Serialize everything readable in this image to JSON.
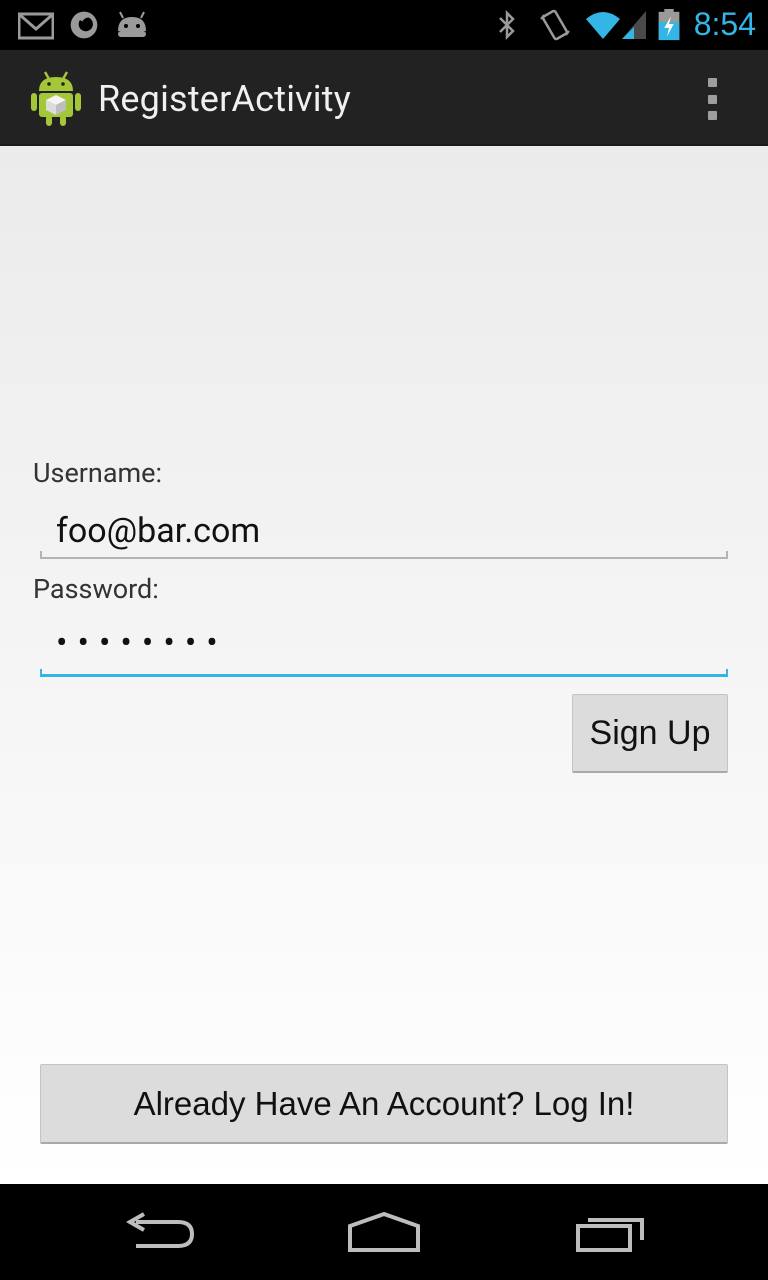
{
  "status_bar": {
    "time": "8:54",
    "icons": [
      "gmail-icon",
      "firefox-icon",
      "android-debug-icon",
      "bluetooth-icon",
      "vibrate-icon",
      "wifi-icon",
      "signal-icon",
      "battery-charging-icon"
    ]
  },
  "action_bar": {
    "title": "RegisterActivity",
    "logo_icon": "android-app-icon",
    "overflow_icon": "overflow-menu-icon"
  },
  "form": {
    "username_label": "Username:",
    "username_value": "foo@bar.com",
    "password_label": "Password:",
    "password_value": "••••••••",
    "signup_button": "Sign Up",
    "login_button": "Already Have An Account? Log In!"
  },
  "nav_bar": {
    "icons": [
      "back-icon",
      "home-icon",
      "recents-icon"
    ]
  },
  "colors": {
    "accent": "#33b5e5",
    "action_bar": "#222222",
    "button": "#dcdcdc"
  }
}
